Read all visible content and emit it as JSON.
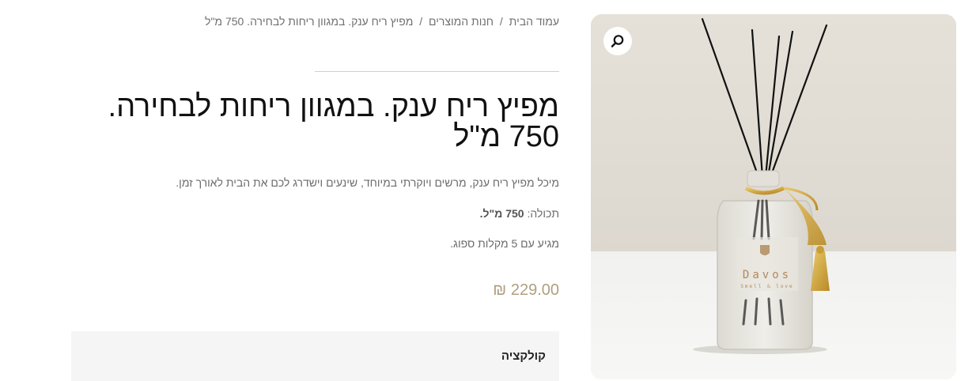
{
  "breadcrumb": {
    "home": "עמוד הבית",
    "shop": "חנות המוצרים",
    "current": "מפיץ ריח ענק. במגוון ריחות לבחירה. 750 מ\"ל",
    "separator": "/"
  },
  "product": {
    "title": "מפיץ ריח ענק. במגוון ריחות לבחירה. 750 מ\"ל",
    "description": "מיכל מפיץ ריח ענק, מרשים ויוקרתי במיוחד, שינעים וישדרג לכם את הבית לאורך זמן.",
    "capacity_label": "תכולה:",
    "capacity_value": "750 מ\"ל.",
    "includes": "מגיע עם 5 מקלות ספוג.",
    "price": "229.00 ₪",
    "collection_label": "קולקציה",
    "image_label": "Davos",
    "image_tagline": "Smell & love"
  },
  "gallery": {
    "zoom_icon": "search-icon"
  },
  "colors": {
    "price": "#b09f80",
    "title": "#111111",
    "muted_text": "#6b6b6b",
    "collection_bg": "#f5f5f5"
  }
}
